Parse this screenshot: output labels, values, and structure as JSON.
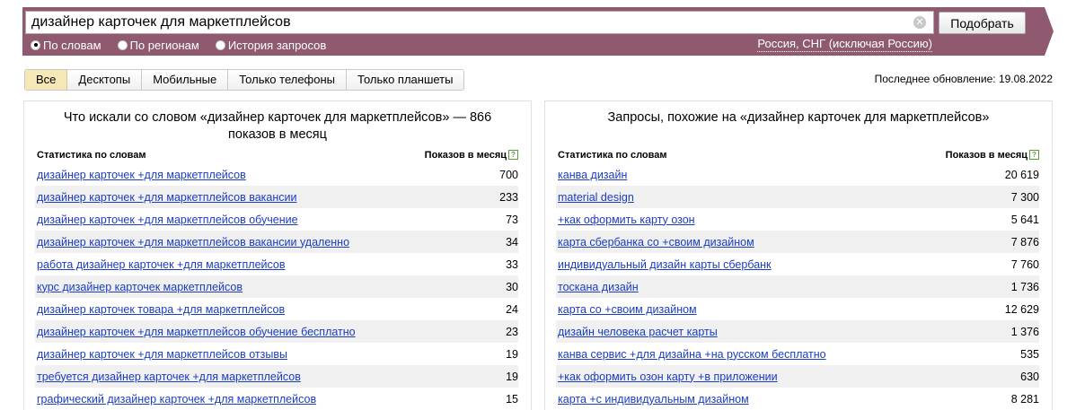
{
  "search": {
    "query": "дизайнер карточек для маркетплейсов",
    "clear_icon": "close-circle-icon",
    "submit_label": "Подобрать",
    "modes": [
      {
        "label": "По словам",
        "selected": true
      },
      {
        "label": "По регионам",
        "selected": false
      },
      {
        "label": "История запросов",
        "selected": false
      }
    ],
    "region": "Россия, СНГ (исключая Россию)"
  },
  "tabs": [
    {
      "label": "Все",
      "active": true
    },
    {
      "label": "Десктопы",
      "active": false
    },
    {
      "label": "Мобильные",
      "active": false
    },
    {
      "label": "Только телефоны",
      "active": false
    },
    {
      "label": "Только планшеты",
      "active": false
    }
  ],
  "last_update": "Последнее обновление: 19.08.2022",
  "left_panel": {
    "title": "Что искали со словом «дизайнер карточек для маркетплейсов» — 866 показов в месяц",
    "col_keyword": "Статистика по словам",
    "col_count": "Показов в месяц",
    "rows": [
      {
        "phrase": "дизайнер карточек +для маркетплейсов",
        "count": "700"
      },
      {
        "phrase": "дизайнер карточек +для маркетплейсов вакансии",
        "count": "233"
      },
      {
        "phrase": "дизайнер карточек +для маркетплейсов обучение",
        "count": "73"
      },
      {
        "phrase": "дизайнер карточек +для маркетплейсов вакансии удаленно",
        "count": "34"
      },
      {
        "phrase": "работа дизайнер карточек +для маркетплейсов",
        "count": "33"
      },
      {
        "phrase": "курс дизайнер карточек маркетплейсов",
        "count": "30"
      },
      {
        "phrase": "дизайнер карточек товара +для маркетплейсов",
        "count": "24"
      },
      {
        "phrase": "дизайнер карточек +для маркетплейсов обучение бесплатно",
        "count": "23"
      },
      {
        "phrase": "дизайнер карточек +для маркетплейсов отзывы",
        "count": "19"
      },
      {
        "phrase": "требуется дизайнер карточек +для маркетплейсов",
        "count": "19"
      },
      {
        "phrase": "графический дизайнер карточек +для маркетплейсов",
        "count": "15"
      }
    ]
  },
  "right_panel": {
    "title": "Запросы, похожие на «дизайнер карточек для маркетплейсов»",
    "col_keyword": "Статистика по словам",
    "col_count": "Показов в месяц",
    "rows": [
      {
        "phrase": "канва дизайн",
        "count": "20 619"
      },
      {
        "phrase": "material design",
        "count": "7 300"
      },
      {
        "phrase": "+как оформить карту озон",
        "count": "5 641"
      },
      {
        "phrase": "карта сбербанка со +своим дизайном",
        "count": "7 876"
      },
      {
        "phrase": "индивидуальный дизайн карты сбербанк",
        "count": "7 760"
      },
      {
        "phrase": "тоскана дизайн",
        "count": "1 736"
      },
      {
        "phrase": "карта со +своим дизайном",
        "count": "12 629"
      },
      {
        "phrase": "дизайн человека расчет карты",
        "count": "1 376"
      },
      {
        "phrase": "канва сервис +для дизайна +на русском бесплатно",
        "count": "535"
      },
      {
        "phrase": "+как оформить озон карту +в приложении",
        "count": "630"
      },
      {
        "phrase": "карта +с индивидуальным дизайном",
        "count": "8 281"
      }
    ]
  }
}
